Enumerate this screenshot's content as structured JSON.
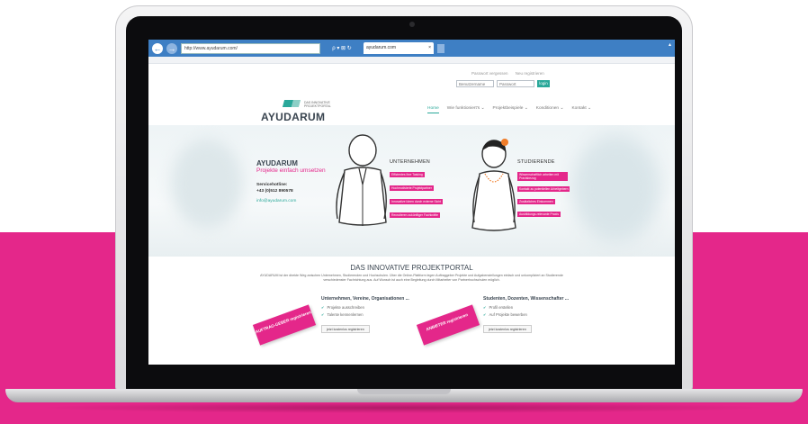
{
  "colors": {
    "brand_pink": "#e4278a",
    "brand_teal": "#2aa89a",
    "browser_blue": "#3e7fc4",
    "band_pink": "#e4278a"
  },
  "browser": {
    "address": "http://www.ayudarum.com/",
    "address_tools": "ρ ▾ ⊠ ↻",
    "tab_title": "ayudarum.com",
    "tab_close": "×"
  },
  "login": {
    "forgot_link": "Passwort vergessen",
    "register_link": "Neu registrieren",
    "username_placeholder": "Benutzername",
    "password_placeholder": "Passwort",
    "button": "login"
  },
  "logo": {
    "text": "AYUDARUM",
    "tagline": "DAS INNOVATIVE PROJEKTPORTAL"
  },
  "nav": [
    {
      "label": "Home",
      "active": true
    },
    {
      "label": "Wie funktioniert's ⌄"
    },
    {
      "label": "Projektbeispiele ⌄"
    },
    {
      "label": "Konditionen ⌄"
    },
    {
      "label": "Kontakt ⌄"
    }
  ],
  "hero": {
    "brand": "AYUDARUM",
    "slogan": "Projekte einfach umsetzen",
    "hotline_label": "Servicehotline:",
    "hotline_number": "+43 (0)512 890578",
    "email": "info@ayudarum.com",
    "companies_title": "UNTERNEHMEN",
    "companies_tags": [
      "Effizientes Ihre Tasking",
      "Hochmotivierte Projektpartner",
      "Innovative Ideen durch externe Sicht",
      "Recrutieren zukünftiger Fachkräfte"
    ],
    "students_title": "STUDIERENDE",
    "students_tags": [
      "Wissenschaftlich arbeiten mit Praxisbezug",
      "Kontakt zu potentiellen Arbeitgebern",
      "Zusätzliches Einkommen",
      "Ausbildungs-relevante Praxis"
    ]
  },
  "content": {
    "title": "DAS INNOVATIVE PROJEKTPORTAL",
    "text": "AYUDARUM ist der direkte Weg zwischen Unternehmen, Studierenden und Hochschulen. Über die Online-Plattform legen Auftraggeber Projekte und Aufgabenstellungen einfach und unkompliziert an Studierende verschiedenster Fachrichtung aus. Auf Wunsch ist auch eine Begleitung durch Mitarbeiter von Partnerhochschulen möglich.",
    "left": {
      "card": "AUFTRAG-GEBER registrieren",
      "head": "Unternehmen, Vereine, Organisationen ...",
      "checks": [
        "Projekte ausschreiben",
        "Talente kennenlernen"
      ],
      "button": "jetzt kostenlos registrieren"
    },
    "right": {
      "card": "ANBIETER registrieren",
      "head": "Studenten, Dozenten, Wissenschafter ...",
      "checks": [
        "Profil erstellen",
        "Auf Projekte bewerben"
      ],
      "button": "jetzt kostenlos registrieren"
    }
  }
}
